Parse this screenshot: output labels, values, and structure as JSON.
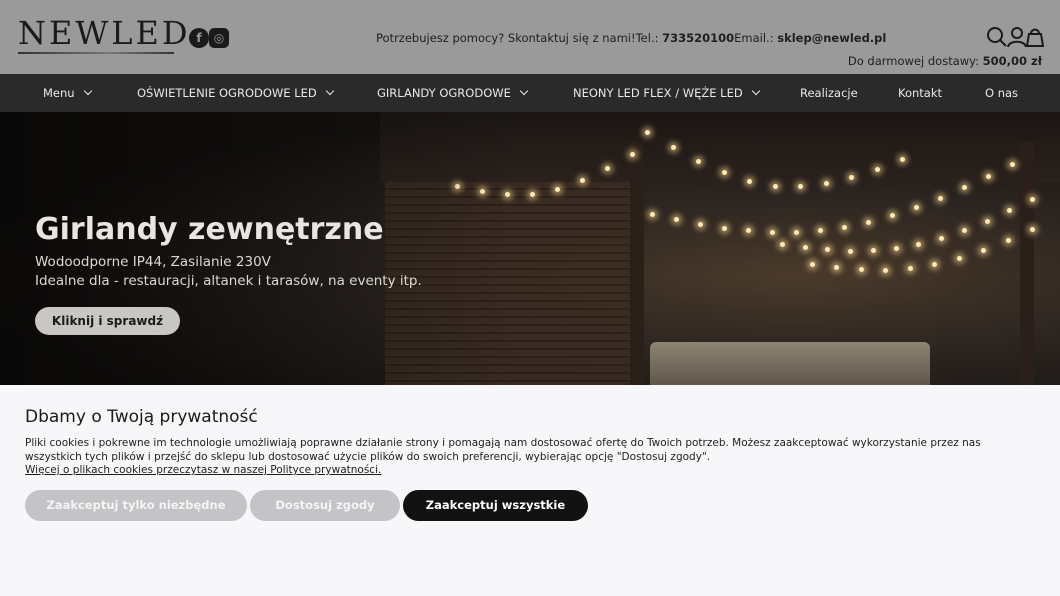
{
  "header": {
    "logo": "NEWLED",
    "social": [
      {
        "name": "facebook",
        "glyph": "f"
      },
      {
        "name": "instagram",
        "glyph": "◎"
      }
    ],
    "contact_prefix": "Potrzebujesz pomocy? Skontaktuj się z nami!Tel.: ",
    "phone": "733520100",
    "email_prefix": "Email.: ",
    "email": "sklep@newled.pl",
    "delivery_prefix": "Do darmowej dostawy: ",
    "delivery_amount": "500,00 zł",
    "icons": [
      "search-icon",
      "user-icon",
      "cart-icon"
    ]
  },
  "nav": {
    "items": [
      {
        "label": "Menu",
        "dropdown": true
      },
      {
        "label": "OŚWIETLENIE OGRODOWE LED",
        "dropdown": true
      },
      {
        "label": "GIRLANDY OGRODOWE",
        "dropdown": true
      },
      {
        "label": "NEONY LED FLEX / WĘŻE LED",
        "dropdown": true
      },
      {
        "label": "Realizacje",
        "dropdown": false
      },
      {
        "label": "Kontakt",
        "dropdown": false
      },
      {
        "label": "O nas",
        "dropdown": false
      }
    ]
  },
  "hero": {
    "title": "Girlandy zewnętrzne",
    "line1": "Wodoodporne IP44, Zasilanie 230V",
    "line2": "Idealne dla - restauracji, altanek i tarasów, na eventy itp.",
    "button": "Kliknij i sprawdź"
  },
  "cookie": {
    "title": "Dbamy o Twoją prywatność",
    "text": "Pliki cookies i pokrewne im technologie umożliwiają poprawne działanie strony i pomagają nam dostosować ofertę do Twoich potrzeb. Możesz zaakceptować wykorzystanie przez nas wszystkich tych plików i przejść do sklepu lub dostosować użycie plików do swoich preferencji, wybierając opcję \"Dostosuj zgody\".",
    "link": "Więcej o plikach cookies przeczytasz w naszej Polityce prywatności.",
    "buttons": {
      "necessary": "Zaakceptuj tylko niezbędne",
      "customize": "Dostosuj zgody",
      "accept_all": "Zaakceptuj wszystkie"
    }
  },
  "colors": {
    "header_bg": "#9a9a9a",
    "nav_bg": "#2a2a2a",
    "accept_all_bg": "#121212",
    "light_button_bg": "#c4c4c6"
  }
}
